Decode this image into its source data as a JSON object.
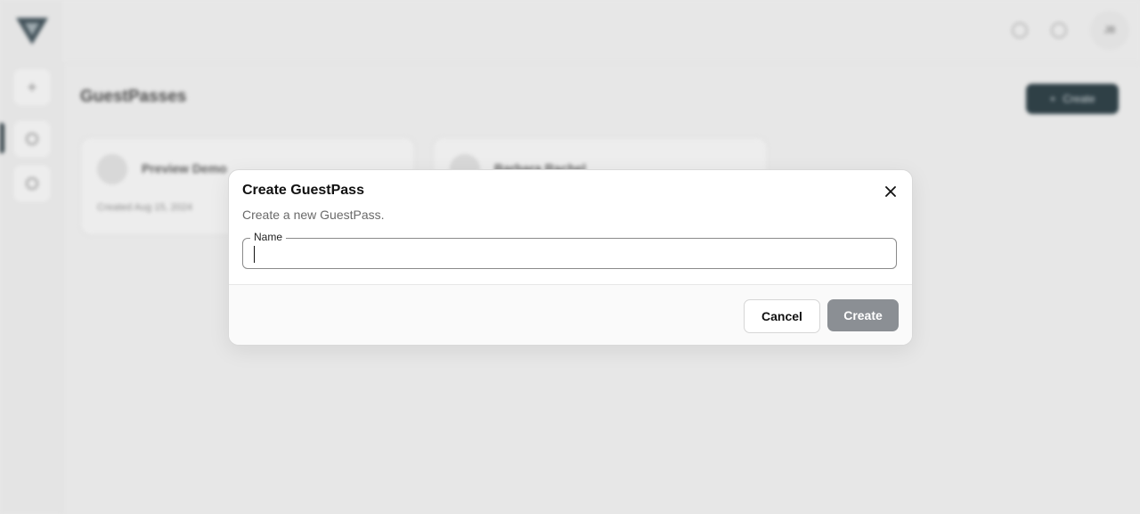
{
  "background": {
    "page_title": "GuestPasses",
    "create_button_label": "Create",
    "avatar_initials": "JB",
    "cards": [
      {
        "name": "Preview Demo",
        "date": "Created Aug 15, 2024"
      },
      {
        "name": "Barbara Rachel"
      }
    ]
  },
  "modal": {
    "title": "Create GuestPass",
    "description": "Create a new GuestPass.",
    "name_field": {
      "label": "Name",
      "value": "",
      "placeholder": ""
    },
    "cancel_label": "Cancel",
    "create_label": "Create",
    "close_icon": "close-icon"
  },
  "colors": {
    "primary_dark": "#24363d",
    "create_disabled": "#8b8f94"
  }
}
